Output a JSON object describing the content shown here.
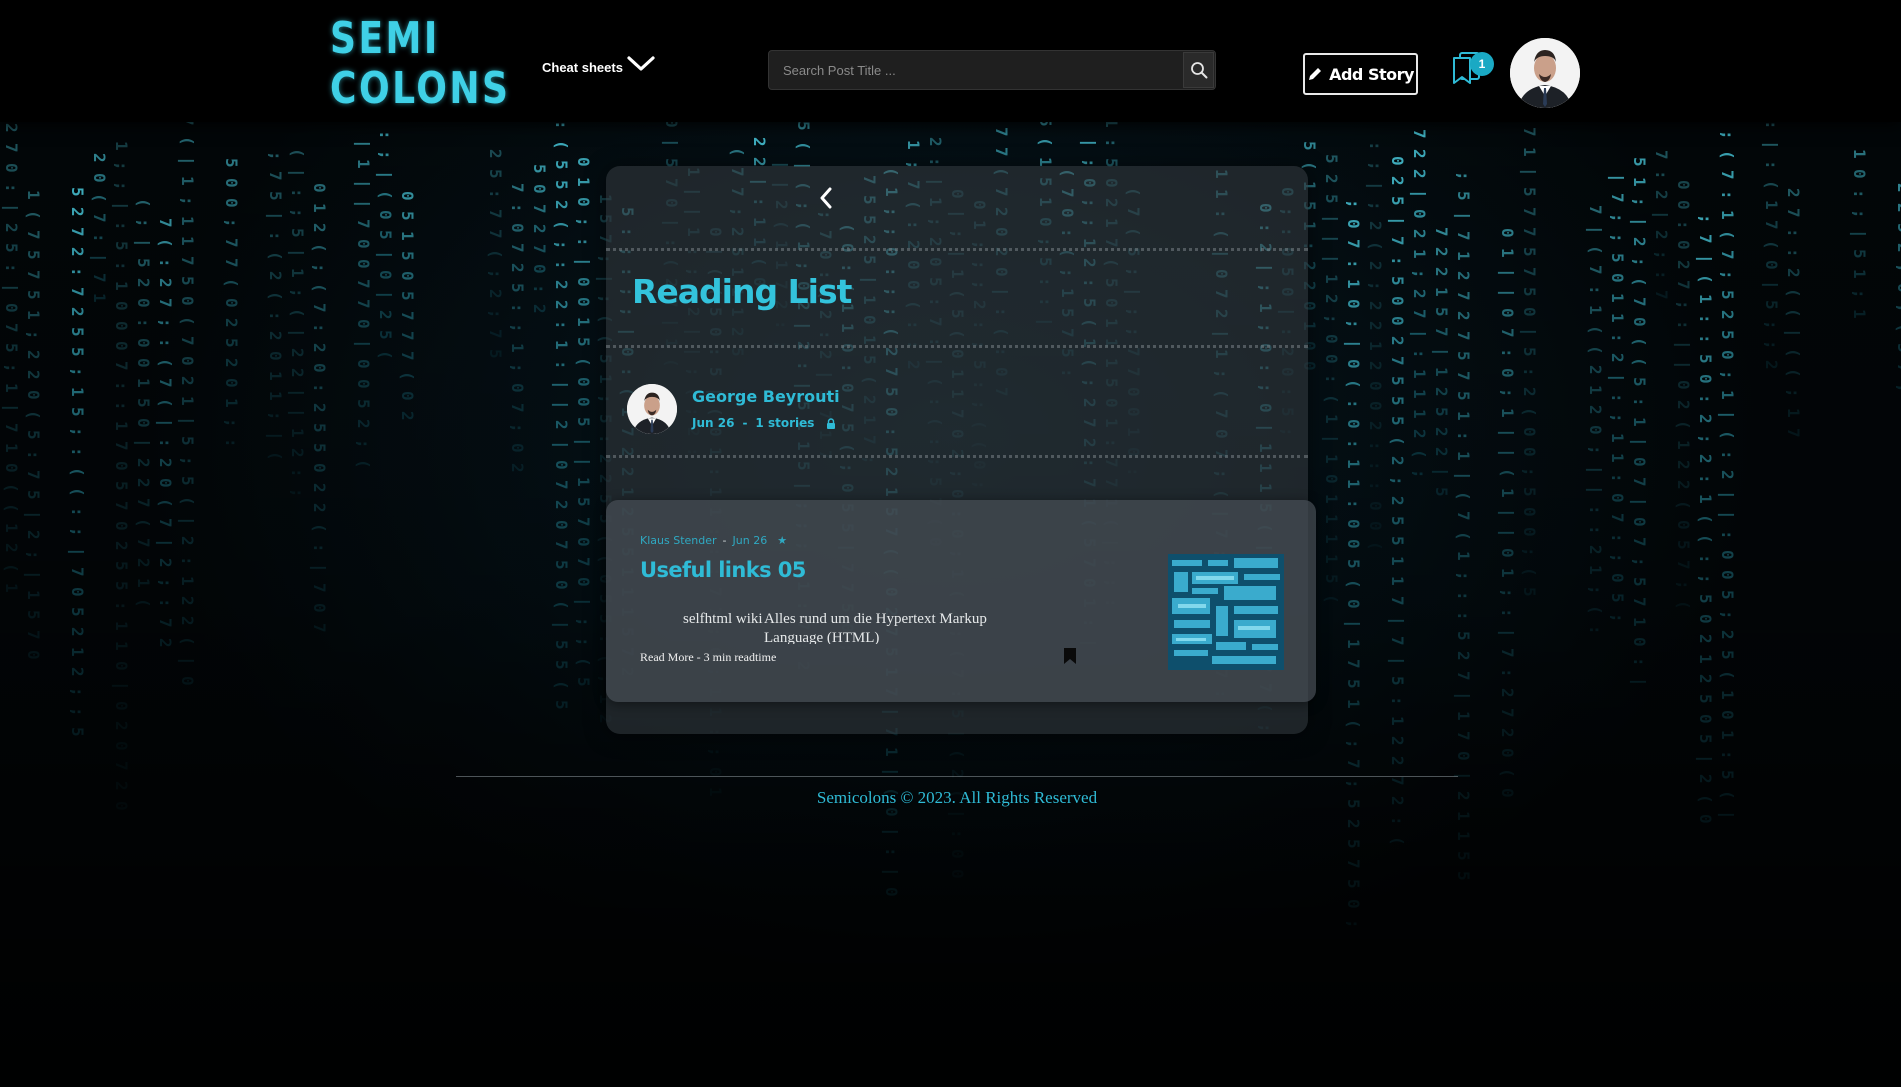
{
  "brand": {
    "logo_line1": "SEMI",
    "logo_line2": "COLONS",
    "accent_color": "#2fbbd6"
  },
  "header": {
    "menu_label": "Cheat sheets",
    "search_placeholder": "Search Post Title ...",
    "search_value": "",
    "add_story_label": "Add Story",
    "bookmark_count": "1"
  },
  "reading_list": {
    "title": "Reading List",
    "owner_name": "George Beyrouti",
    "date": "Jun 26",
    "separator": "-",
    "stories_count": "1 stories",
    "visibility_icon": "lock-icon"
  },
  "stories": [
    {
      "author": "Klaus Stender",
      "separator": "-",
      "date": "Jun 26",
      "featured_icon": "star-icon",
      "title": "Useful links 05",
      "excerpt_col1": "selfhtml wiki",
      "excerpt_col2": "Alles rund um die Hypertext Markup Language (HTML)",
      "read_more": "Read More - 3 min readtime"
    }
  ],
  "footer": {
    "copyright": "Semicolons © 2023. All Rights Reserved"
  }
}
